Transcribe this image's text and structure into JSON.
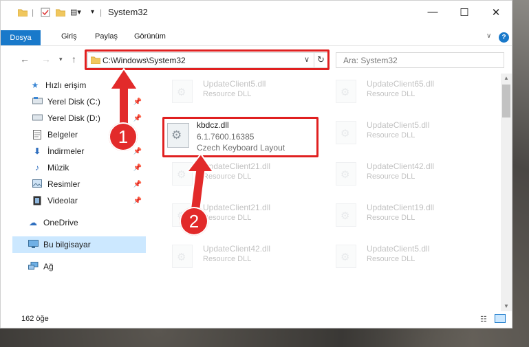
{
  "window": {
    "title": "System32"
  },
  "ribbon": {
    "tabs": [
      "Dosya",
      "Giriş",
      "Paylaş",
      "Görünüm"
    ]
  },
  "nav": {
    "address": "C:\\Windows\\System32",
    "search_placeholder": "Ara: System32"
  },
  "sidebar": {
    "items": [
      {
        "label": "Hızlı erişim",
        "icon": "star-icon"
      },
      {
        "label": "Yerel Disk (C:)",
        "icon": "drive-icon"
      },
      {
        "label": "Yerel Disk (D:)",
        "icon": "drive-icon"
      },
      {
        "label": "Belgeler",
        "icon": "document-icon"
      },
      {
        "label": "İndirmeler",
        "icon": "download-icon"
      },
      {
        "label": "Müzik",
        "icon": "music-icon"
      },
      {
        "label": "Resimler",
        "icon": "pictures-icon"
      },
      {
        "label": "Videolar",
        "icon": "video-icon"
      },
      {
        "label": "OneDrive",
        "icon": "cloud-icon"
      },
      {
        "label": "Bu bilgisayar",
        "icon": "computer-icon"
      },
      {
        "label": "Ağ",
        "icon": "network-icon"
      }
    ]
  },
  "files": {
    "left": [
      {
        "name": "UpdateClient5.dll",
        "type": "Resource DLL"
      },
      {
        "name": "UpdateClient21.dll",
        "type": "Resource DLL"
      },
      {
        "name": "UpdateClient21.dll",
        "type": "Resource DLL"
      },
      {
        "name": "UpdateClient42.dll",
        "type": "Resource DLL"
      }
    ],
    "right": [
      {
        "name": "UpdateClient65.dll",
        "type": "Resource DLL"
      },
      {
        "name": "UpdateClient5.dll",
        "type": "Resource DLL"
      },
      {
        "name": "UpdateClient42.dll",
        "type": "Resource DLL"
      },
      {
        "name": "UpdateClient19.dll",
        "type": "Resource DLL"
      },
      {
        "name": "UpdateClient5.dll",
        "type": "Resource DLL"
      }
    ],
    "highlight": {
      "name": "kbdcz.dll",
      "version": "6.1.7600.16385",
      "description": "Czech Keyboard Layout"
    }
  },
  "status": {
    "count": "162 öğe"
  },
  "badges": {
    "one": "1",
    "two": "2"
  },
  "colors": {
    "accent": "#1979ca",
    "annotation": "#e02020",
    "selection": "#cce8ff"
  }
}
